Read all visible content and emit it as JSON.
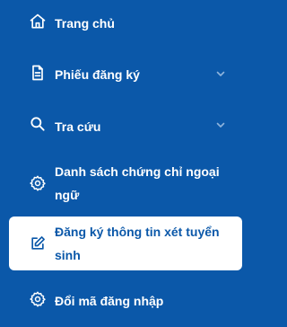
{
  "sidebar": {
    "items": [
      {
        "label": "Trang chủ",
        "icon": "home-icon"
      },
      {
        "label": "Phiếu đăng ký",
        "icon": "document-icon",
        "expandable": true
      },
      {
        "label": "Tra cứu",
        "icon": "search-icon",
        "expandable": true
      },
      {
        "label": "Danh sách chứng chỉ ngoại ngữ",
        "icon": "gear-icon"
      },
      {
        "label": "Đăng ký thông tin xét tuyển sinh",
        "icon": "edit-icon",
        "active": true
      },
      {
        "label": "Đổi mã đăng nhập",
        "icon": "gear-icon"
      }
    ]
  },
  "colors": {
    "sidebar_background": "#0b58a9",
    "active_background": "#ffffff",
    "active_text": "#0b58a9",
    "text": "#ffffff"
  }
}
